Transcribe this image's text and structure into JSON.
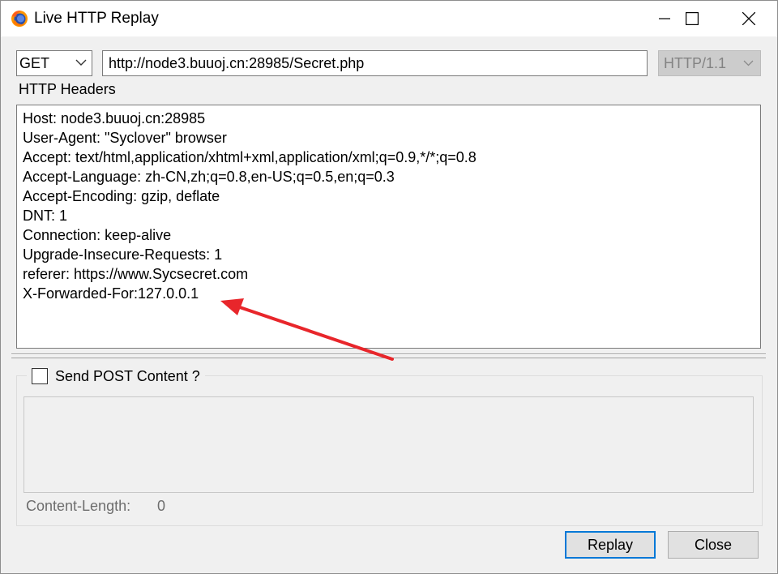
{
  "window": {
    "title": "Live HTTP Replay"
  },
  "request": {
    "method": "GET",
    "url": "http://node3.buuoj.cn:28985/Secret.php",
    "version": "HTTP/1.1"
  },
  "headers_label": "HTTP Headers",
  "headers": [
    "Host: node3.buuoj.cn:28985",
    "User-Agent: \"Syclover\" browser",
    "Accept: text/html,application/xhtml+xml,application/xml;q=0.9,*/*;q=0.8",
    "Accept-Language: zh-CN,zh;q=0.8,en-US;q=0.5,en;q=0.3",
    "Accept-Encoding: gzip, deflate",
    "DNT: 1",
    "Connection: keep-alive",
    "Upgrade-Insecure-Requests: 1",
    "referer: https://www.Sycsecret.com",
    "X-Forwarded-For:127.0.0.1"
  ],
  "post": {
    "checkbox_label": "Send POST Content ?",
    "checked": false,
    "content": "",
    "content_length_label": "Content-Length:",
    "content_length_value": "0"
  },
  "buttons": {
    "replay": "Replay",
    "close": "Close"
  },
  "colors": {
    "annotation_arrow": "#e8262b",
    "focus_border": "#0078d7"
  }
}
